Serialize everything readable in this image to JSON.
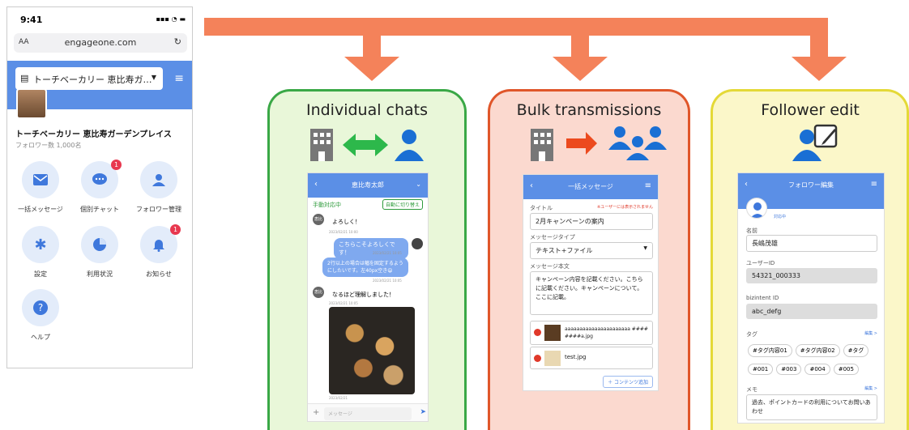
{
  "phone": {
    "time": "9:41",
    "signal": "▪▪▪ ◔ ▬",
    "font_size_label": "AA",
    "url": "engageone.com",
    "store_select": "トーチベーカリー 恵比寿ガ…",
    "store_name": "トーチベーカリー 恵比寿ガーデンプレイス",
    "followers": "フォロワー数 1,000名",
    "menu": [
      {
        "label": "一括メッセージ",
        "icon": "envelope-icon",
        "badge": ""
      },
      {
        "label": "個別チャット",
        "icon": "chat-bubble-icon",
        "badge": "1"
      },
      {
        "label": "フォロワー管理",
        "icon": "user-icon",
        "badge": ""
      },
      {
        "label": "設定",
        "icon": "gear-icon",
        "badge": ""
      },
      {
        "label": "利用状況",
        "icon": "pie-chart-icon",
        "badge": ""
      },
      {
        "label": "お知らせ",
        "icon": "bell-icon",
        "badge": "1"
      },
      {
        "label": "ヘルプ",
        "icon": "question-icon",
        "badge": ""
      }
    ]
  },
  "panels": {
    "chats": {
      "title": "Individual chats",
      "color": "#3aa846",
      "bg": "#e9f7d9"
    },
    "bulk": {
      "title": "Bulk transmissions",
      "color": "#e0562a",
      "bg": "#fbd9cf"
    },
    "follower": {
      "title": "Follower edit",
      "color": "#e4d937",
      "bg": "#fbf7c9"
    }
  },
  "chat": {
    "header": "恵比寿太郎",
    "status": "手動対応中",
    "auto_btn": "自動に切り替え",
    "msgs": [
      {
        "text": "よろしく！",
        "time": "2023/02/21 10:00"
      },
      {
        "text": "こちらこそよろしくです！",
        "time": "2023/02/21 10:05"
      },
      {
        "text": "2行以上の場合は幅を固定するようにしたいです。左40px空き😄",
        "time": "2023/02/21 10:05"
      },
      {
        "text": "なるほど理解しました！",
        "time": "2023/02/21 10:05"
      }
    ],
    "img_time": "2023/02/21",
    "placeholder": "メッセージ",
    "avatar_label": "恵比"
  },
  "bulk": {
    "header": "一括メッセージ",
    "title_label": "タイトル",
    "warning": "※ユーザーには表示されません",
    "title_value": "2月キャンペーンの案内",
    "type_label": "メッセージタイプ",
    "type_value": "テキスト+ファイル",
    "body_label": "メッセージ本文",
    "body_value": "キャンペーン内容を記載ください。こちらに記載ください。キャンペーンについて。ここに記載。",
    "file1": "aaaaaaaaaaaaaaaaaaaaaa ########a.jpg",
    "file2": "test.jpg",
    "add_btn": "＋ コンテンツ追加"
  },
  "follower": {
    "header": "フォロワー編集",
    "status": "対応中",
    "name_label": "名前",
    "name_value": "長嶋茂雄",
    "uid_label": "ユーザーID",
    "uid_value": "54321_000333",
    "bid_label": "bizintent ID",
    "bid_value": "abc_defg",
    "tag_label": "タグ",
    "edit": "編集 >",
    "tags": [
      "#タグ内容01",
      "#タグ内容02",
      "#タグ",
      "#001",
      "#003",
      "#004",
      "#005"
    ],
    "memo_label": "メモ",
    "memo_value": "過去、ポイントカードの利用についてお問いあわせ"
  }
}
